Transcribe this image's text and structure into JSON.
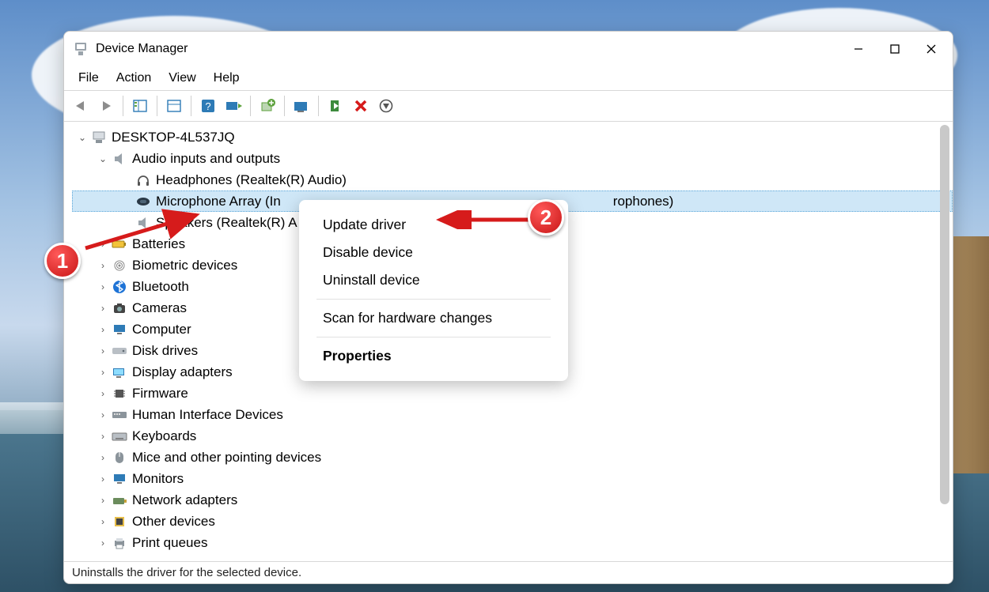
{
  "window": {
    "title": "Device Manager",
    "menus": {
      "file": "File",
      "action": "Action",
      "view": "View",
      "help": "Help"
    }
  },
  "tree": {
    "root": "DESKTOP-4L537JQ",
    "cat_audio": "Audio inputs and outputs",
    "dev_headphones": "Headphones (Realtek(R) Audio)",
    "dev_mic_visible_prefix": "Microphone Array (In",
    "dev_mic_visible_suffix": "rophones)",
    "dev_speakers": "Speakers (Realtek(R) A",
    "cat_batteries": "Batteries",
    "cat_biometric": "Biometric devices",
    "cat_bluetooth": "Bluetooth",
    "cat_cameras": "Cameras",
    "cat_computer": "Computer",
    "cat_disk": "Disk drives",
    "cat_display": "Display adapters",
    "cat_firmware": "Firmware",
    "cat_hid": "Human Interface Devices",
    "cat_keyboards": "Keyboards",
    "cat_mice": "Mice and other pointing devices",
    "cat_monitors": "Monitors",
    "cat_network": "Network adapters",
    "cat_other": "Other devices",
    "cat_print": "Print queues"
  },
  "contextmenu": {
    "update": "Update driver",
    "disable": "Disable device",
    "uninstall": "Uninstall device",
    "scan": "Scan for hardware changes",
    "properties": "Properties"
  },
  "status": "Uninstalls the driver for the selected device.",
  "annotations": {
    "badge1": "1",
    "badge2": "2"
  }
}
